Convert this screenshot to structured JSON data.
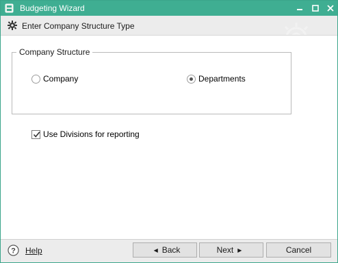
{
  "window": {
    "title": "Budgeting Wizard"
  },
  "header": {
    "title": "Enter Company Structure Type"
  },
  "company_structure": {
    "legend": "Company Structure",
    "options": [
      {
        "label": "Company",
        "selected": false
      },
      {
        "label": "Departments",
        "selected": true
      }
    ]
  },
  "divisions": {
    "label": "Use Divisions for reporting",
    "checked": true
  },
  "footer": {
    "help_label": "Help",
    "back_label": "Back",
    "next_label": "Next",
    "cancel_label": "Cancel"
  },
  "colors": {
    "titlebar": "#3fae92",
    "header_bg": "#ececec",
    "footer_bg": "#ececec"
  }
}
